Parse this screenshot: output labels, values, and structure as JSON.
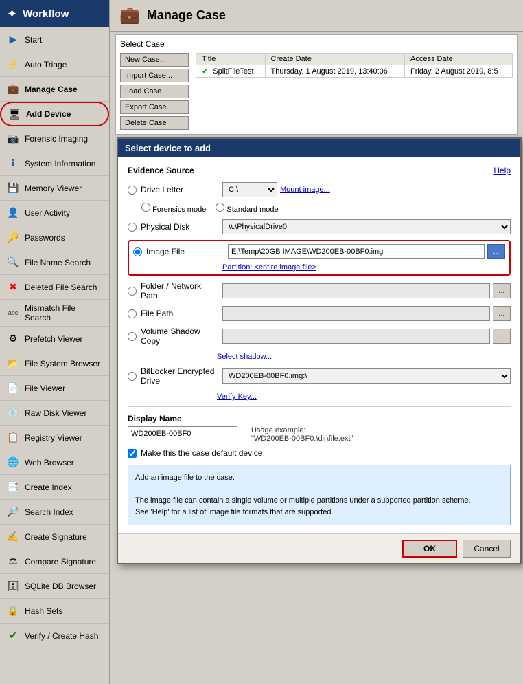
{
  "sidebar": {
    "header": {
      "title": "Workflow",
      "icon": "workflow-icon"
    },
    "items": [
      {
        "id": "start",
        "label": "Start",
        "icon": "start-icon",
        "active": false
      },
      {
        "id": "auto-triage",
        "label": "Auto Triage",
        "icon": "triage-icon",
        "active": false
      },
      {
        "id": "manage-case",
        "label": "Manage Case",
        "icon": "manage-icon",
        "active": false,
        "bold": true
      },
      {
        "id": "add-device",
        "label": "Add Device",
        "icon": "device-icon",
        "active": false,
        "bold": true,
        "highlighted": true
      },
      {
        "id": "forensic-imaging",
        "label": "Forensic Imaging",
        "icon": "imaging-icon",
        "active": false
      },
      {
        "id": "system-information",
        "label": "System Information",
        "icon": "sysinfo-icon",
        "active": false
      },
      {
        "id": "memory-viewer",
        "label": "Memory Viewer",
        "icon": "memory-icon",
        "active": false
      },
      {
        "id": "user-activity",
        "label": "User Activity",
        "icon": "useractivity-icon",
        "active": false
      },
      {
        "id": "passwords",
        "label": "Passwords",
        "icon": "passwords-icon",
        "active": false
      },
      {
        "id": "file-name-search",
        "label": "File Name Search",
        "icon": "filename-icon",
        "active": false
      },
      {
        "id": "deleted-file-search",
        "label": "Deleted File Search",
        "icon": "deleted-icon",
        "active": false
      },
      {
        "id": "mismatch-file-search",
        "label": "Mismatch File Search",
        "icon": "mismatch-icon",
        "active": false
      },
      {
        "id": "prefetch-viewer",
        "label": "Prefetch Viewer",
        "icon": "prefetch-icon",
        "active": false
      },
      {
        "id": "file-system-browser",
        "label": "File System Browser",
        "icon": "fsb-icon",
        "active": false
      },
      {
        "id": "file-viewer",
        "label": "File Viewer",
        "icon": "fileviewer-icon",
        "active": false
      },
      {
        "id": "raw-disk-viewer",
        "label": "Raw Disk Viewer",
        "icon": "rawdisk-icon",
        "active": false
      },
      {
        "id": "registry-viewer",
        "label": "Registry Viewer",
        "icon": "registry-icon",
        "active": false
      },
      {
        "id": "web-browser",
        "label": "Web Browser",
        "icon": "webbrowser-icon",
        "active": false
      },
      {
        "id": "create-index",
        "label": "Create Index",
        "icon": "createindex-icon",
        "active": false
      },
      {
        "id": "search-index",
        "label": "Search Index",
        "icon": "searchindex-icon",
        "active": false
      },
      {
        "id": "create-signature",
        "label": "Create Signature",
        "icon": "createsig-icon",
        "active": false
      },
      {
        "id": "compare-signature",
        "label": "Compare Signature",
        "icon": "comparesig-icon",
        "active": false
      },
      {
        "id": "sqlite-db-browser",
        "label": "SQLite DB Browser",
        "icon": "sqlite-icon",
        "active": false
      },
      {
        "id": "hash-sets",
        "label": "Hash Sets",
        "icon": "hashsets-icon",
        "active": false
      },
      {
        "id": "verify-create",
        "label": "Verify / Create Hash",
        "icon": "verify-icon",
        "active": false
      }
    ]
  },
  "manage_case": {
    "title": "Manage Case",
    "select_case_label": "Select Case",
    "buttons": [
      {
        "id": "new-case",
        "label": "New Case..."
      },
      {
        "id": "import-case",
        "label": "Import Case..."
      },
      {
        "id": "load-case",
        "label": "Load Case"
      },
      {
        "id": "export-case",
        "label": "Export Case..."
      },
      {
        "id": "delete-case",
        "label": "Delete Case"
      }
    ],
    "table": {
      "columns": [
        "Title",
        "Create Date",
        "Access Date"
      ],
      "rows": [
        {
          "check": "✔",
          "title": "SplitFileTest",
          "create_date": "Thursday, 1 August 2019, 13:40:06",
          "access_date": "Friday, 2 August 2019, 8:5"
        }
      ]
    }
  },
  "dialog": {
    "title": "Select device to add",
    "evidence_source_label": "Evidence Source",
    "help_label": "Help",
    "options": [
      {
        "id": "drive-letter",
        "label": "Drive Letter"
      },
      {
        "id": "physical-disk",
        "label": "Physical Disk"
      },
      {
        "id": "image-file",
        "label": "Image File"
      },
      {
        "id": "folder-network",
        "label": "Folder / Network Path"
      },
      {
        "id": "file-path",
        "label": "File Path"
      },
      {
        "id": "volume-shadow",
        "label": "Volume Shadow Copy"
      },
      {
        "id": "bitlocker",
        "label": "BitLocker Encrypted Drive"
      }
    ],
    "drive_letter_value": "C:\\",
    "mount_image_label": "Mount image...",
    "forensics_mode_label": "Forensics mode",
    "standard_mode_label": "Standard mode",
    "physical_disk_value": "\\\\.\\PhysicalDrive0",
    "image_file_path": "E:\\Temp\\20GB IMAGE\\WD200EB-00BF0.img",
    "partition_label": "Partition: <entire image file>",
    "folder_network_placeholder": "",
    "file_path_placeholder": "",
    "volume_shadow_placeholder": "",
    "bitlocker_value": "WD200EB-00BF0.img:\\",
    "verify_key_label": "Verify Key...",
    "select_shadow_label": "Select shadow...",
    "display_name_label": "Display Name",
    "display_name_value": "WD200EB-00BF0",
    "usage_example_label": "Usage example:",
    "usage_example_value": "\"WD200EB-00BF0:\\dir\\file.ext\"",
    "make_default_label": "Make this the case default device",
    "make_default_checked": true,
    "info_text_line1": "Add an image file to the case.",
    "info_text_line2": "The image file can contain a single volume or multiple partitions under a supported partition scheme.",
    "info_text_line3": "See 'Help' for a list of image file formats that are supported.",
    "ok_label": "OK",
    "cancel_label": "Cancel",
    "browse_label": "...",
    "selected_option": "image-file"
  }
}
